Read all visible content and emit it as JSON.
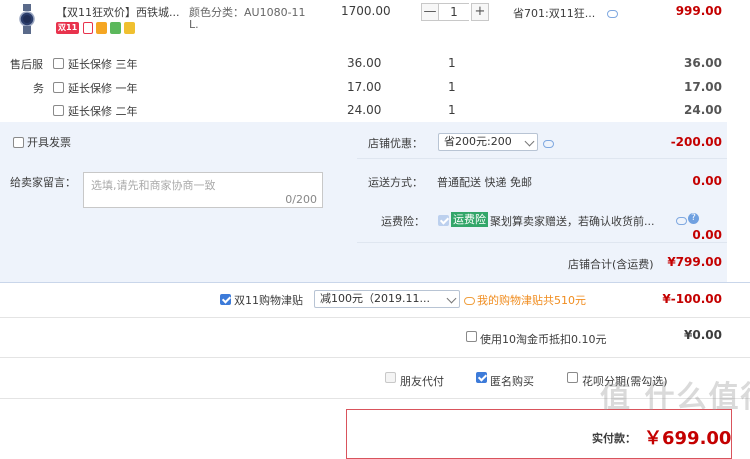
{
  "item": {
    "title": "【双11狂欢价】西铁城...",
    "sku_label": "颜色分类：AU1080-11",
    "sku_label_line2": "L.",
    "unit_price": "1700.00",
    "quantity": "1",
    "qty_minus": "—",
    "qty_plus": "+",
    "discount_text": "省701:双11狂...",
    "subtotal": "999.00",
    "badge_double11": "双11"
  },
  "aftersale": {
    "label_line1": "售后服",
    "label_line2": "务",
    "options": [
      {
        "label": "延长保修 三年",
        "price": "36.00",
        "qty": "1",
        "total": "36.00"
      },
      {
        "label": "延长保修 一年",
        "price": "17.00",
        "qty": "1",
        "total": "17.00"
      },
      {
        "label": "延长保修 二年",
        "price": "24.00",
        "qty": "1",
        "total": "24.00"
      }
    ]
  },
  "order": {
    "invoice_label": "开具发票",
    "shop_discount_label": "店铺优惠：",
    "shop_discount_value": "省200元:200",
    "shop_discount_amount": "-200.00",
    "message_label": "给卖家留言：",
    "message_placeholder": "选填,请先和商家协商一致",
    "message_counter": "0/200",
    "shipping_label": "运送方式：",
    "shipping_value": "普通配送 快递 免邮",
    "shipping_amount": "0.00",
    "insurance_label": "运费险：",
    "insurance_tag": "运费险",
    "insurance_text": "聚划算卖家赠送，若确认收货前...",
    "insurance_amount": "0.00",
    "shop_total_label": "店铺合计(含运费)",
    "shop_total_value": "¥799.00"
  },
  "allowance": {
    "label": "双11购物津贴",
    "select_value": "减100元（2019.11...",
    "note": "我的购物津贴共510元",
    "amount": "¥-100.00"
  },
  "coins": {
    "label": "使用10淘金币抵扣0.10元",
    "amount": "¥0.00"
  },
  "options": {
    "friend_pay": "朋友代付",
    "anonymous": "匿名购买",
    "huabei": "花呗分期(需勾选)"
  },
  "payment": {
    "label": "实付款：",
    "value": "￥699.00"
  },
  "watermark": "值 什么值得买",
  "colors": {
    "accent_red": "#c40000",
    "band_blue": "#eef3fb",
    "check_blue": "#3d7bd9"
  }
}
